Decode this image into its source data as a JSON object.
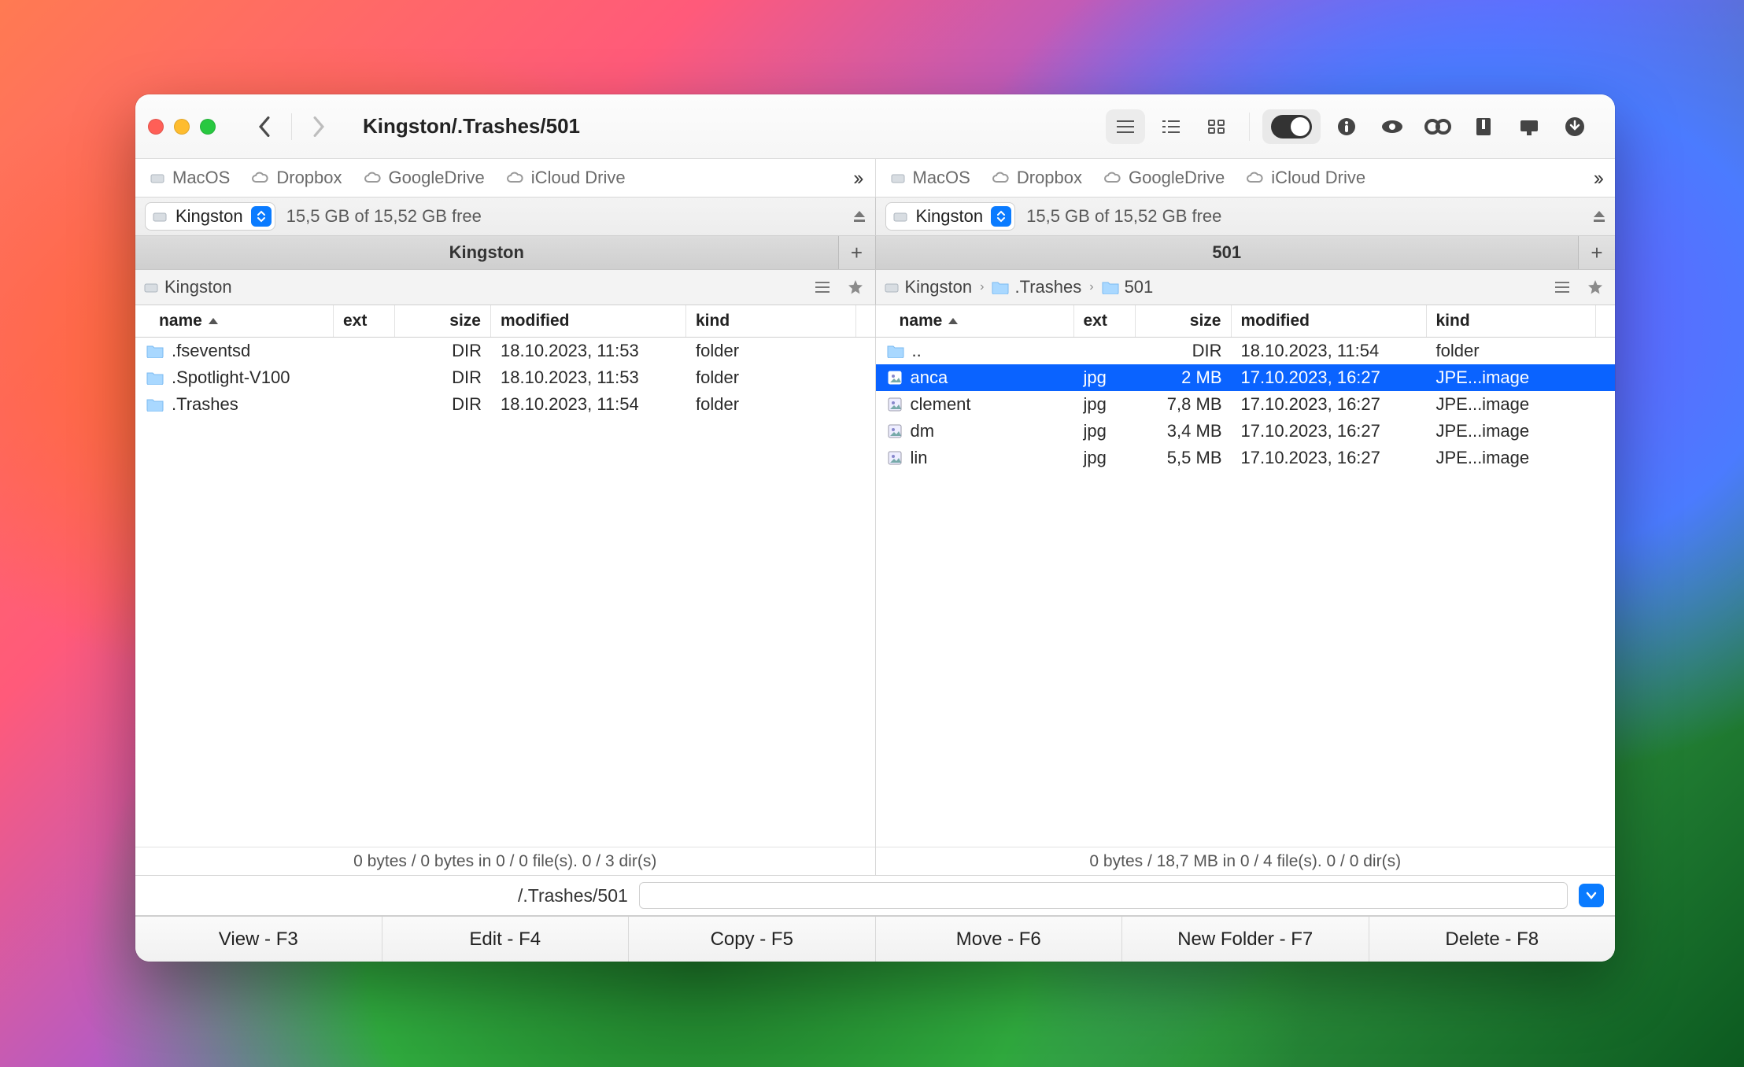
{
  "title": "Kingston/.Trashes/501",
  "favorites": [
    {
      "label": "MacOS",
      "icon": "disk"
    },
    {
      "label": "Dropbox",
      "icon": "cloud"
    },
    {
      "label": "GoogleDrive",
      "icon": "cloud"
    },
    {
      "label": "iCloud Drive",
      "icon": "cloud"
    }
  ],
  "left": {
    "drive_label": "Kingston",
    "free_text": "15,5 GB of 15,52 GB free",
    "tab": "Kingston",
    "breadcrumb": [
      {
        "label": "Kingston",
        "icon": "disk"
      }
    ],
    "columns": [
      "name",
      "ext",
      "size",
      "modified",
      "kind"
    ],
    "rows": [
      {
        "icon": "folder",
        "name": ".fseventsd",
        "ext": "",
        "size": "DIR",
        "modified": "18.10.2023, 11:53",
        "kind": "folder"
      },
      {
        "icon": "folder",
        "name": ".Spotlight-V100",
        "ext": "",
        "size": "DIR",
        "modified": "18.10.2023, 11:53",
        "kind": "folder"
      },
      {
        "icon": "folder",
        "name": ".Trashes",
        "ext": "",
        "size": "DIR",
        "modified": "18.10.2023, 11:54",
        "kind": "folder"
      }
    ],
    "status": "0 bytes / 0 bytes in 0 / 0 file(s). 0 / 3 dir(s)"
  },
  "right": {
    "drive_label": "Kingston",
    "free_text": "15,5 GB of 15,52 GB free",
    "tab": "501",
    "breadcrumb": [
      {
        "label": "Kingston",
        "icon": "disk"
      },
      {
        "label": ".Trashes",
        "icon": "folder"
      },
      {
        "label": "501",
        "icon": "folder"
      }
    ],
    "columns": [
      "name",
      "ext",
      "size",
      "modified",
      "kind"
    ],
    "rows": [
      {
        "icon": "folder",
        "name": "..",
        "ext": "",
        "size": "DIR",
        "modified": "18.10.2023, 11:54",
        "kind": "folder"
      },
      {
        "icon": "image",
        "name": "anca",
        "ext": "jpg",
        "size": "2 MB",
        "modified": "17.10.2023, 16:27",
        "kind": "JPE...image",
        "selected": true
      },
      {
        "icon": "image",
        "name": "clement",
        "ext": "jpg",
        "size": "7,8 MB",
        "modified": "17.10.2023, 16:27",
        "kind": "JPE...image"
      },
      {
        "icon": "image",
        "name": "dm",
        "ext": "jpg",
        "size": "3,4 MB",
        "modified": "17.10.2023, 16:27",
        "kind": "JPE...image"
      },
      {
        "icon": "image",
        "name": "lin",
        "ext": "jpg",
        "size": "5,5 MB",
        "modified": "17.10.2023, 16:27",
        "kind": "JPE...image"
      }
    ],
    "status": "0 bytes / 18,7 MB in 0 / 4 file(s). 0 / 0 dir(s)"
  },
  "path_label": "/.Trashes/501",
  "path_value": "",
  "fkeys": [
    "View - F3",
    "Edit - F4",
    "Copy - F5",
    "Move - F6",
    "New Folder - F7",
    "Delete - F8"
  ]
}
